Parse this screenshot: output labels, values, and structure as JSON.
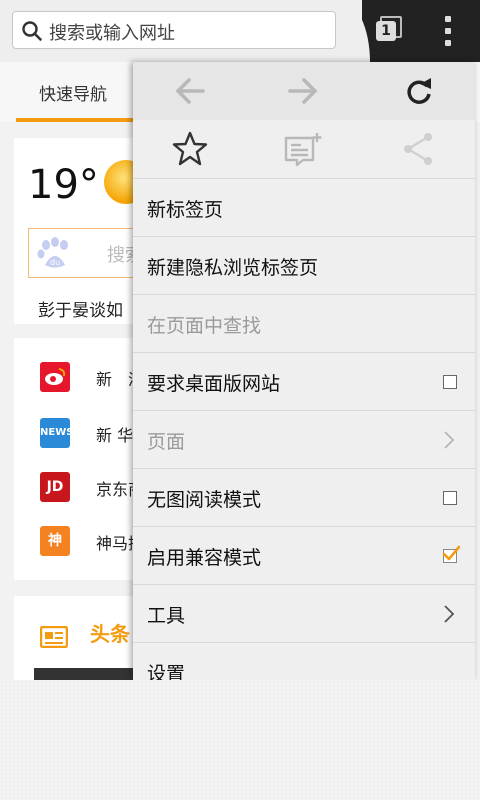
{
  "colors": {
    "accent": "#f39c12",
    "topbar": "#222222",
    "menu_bg": "#efefef",
    "disabled_text": "#9a9a9a",
    "check_orange": "#f39c12"
  },
  "url_bar": {
    "placeholder": "搜索或输入网址",
    "icon": "search-icon"
  },
  "toolbar": {
    "tab_count": "1",
    "menu_icon": "overflow-menu-icon"
  },
  "page": {
    "nav_tab_active": "快速导航",
    "weather": {
      "temperature": "19°"
    },
    "search_placeholder": "搜索",
    "headline": "彭于晏谈如",
    "sites": [
      {
        "label": "新　浪",
        "icon": "sina-weibo-icon",
        "color": "#e6162d"
      },
      {
        "label": "新 华 网",
        "icon": "xinhua-news-icon",
        "color": "#2a8ad8"
      },
      {
        "label": "京东商",
        "icon": "jd-icon",
        "color": "#c8161d"
      },
      {
        "label": "神马搜",
        "icon": "shenma-icon",
        "color": "#f58220"
      }
    ],
    "news_section": "头条"
  },
  "menu": {
    "nav": {
      "back": "back-arrow-icon",
      "forward": "forward-arrow-icon",
      "reload": "reload-icon"
    },
    "actions": {
      "bookmark": "star-icon",
      "reading_list": "add-reading-list-icon",
      "share": "share-icon"
    },
    "items": [
      {
        "label": "新标签页"
      },
      {
        "label": "新建隐私浏览标签页"
      },
      {
        "label": "在页面中查找"
      },
      {
        "label": "要求桌面版网站"
      },
      {
        "label": "页面"
      },
      {
        "label": "无图阅读模式"
      },
      {
        "label": "启用兼容模式"
      },
      {
        "label": "工具"
      },
      {
        "label": "设置"
      }
    ]
  }
}
